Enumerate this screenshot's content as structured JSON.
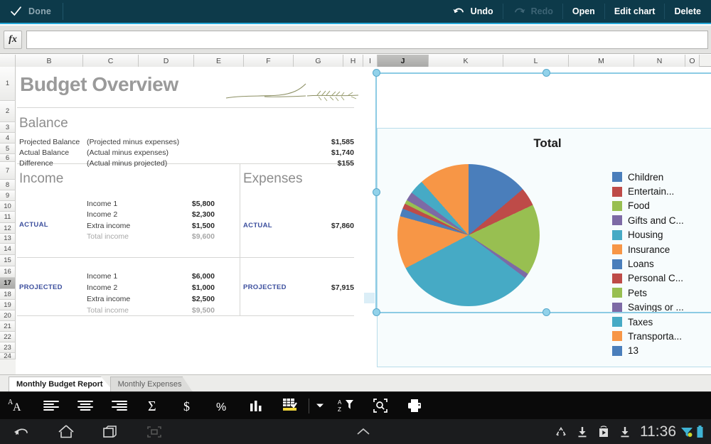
{
  "topbar": {
    "done_label": "Done",
    "check_icon": "check-icon",
    "undo_label": "Undo",
    "redo_label": "Redo",
    "open_label": "Open",
    "edit_chart_label": "Edit chart",
    "delete_label": "Delete",
    "undo_icon": "undo-arrow-icon",
    "redo_icon": "redo-arrow-icon",
    "redo_disabled": true,
    "bg_color": "#0d3a4a",
    "accent_color": "#27a8d8"
  },
  "formula_bar": {
    "fx_label": "fx",
    "value": "",
    "placeholder": ""
  },
  "spreadsheet": {
    "columns": [
      "B",
      "C",
      "D",
      "E",
      "F",
      "G",
      "H",
      "I",
      "J",
      "K",
      "L",
      "M",
      "N",
      "O"
    ],
    "selected_column": "J",
    "rows": [
      "1",
      "2",
      "3",
      "4",
      "5",
      "6",
      "7",
      "8",
      "9",
      "10",
      "11",
      "12",
      "13",
      "14",
      "15",
      "16",
      "17",
      "18",
      "19",
      "20",
      "21",
      "22",
      "23",
      "24"
    ],
    "selected_row": "17",
    "title": "Budget Overview",
    "sections": {
      "balance_heading": "Balance",
      "income_heading": "Income",
      "expenses_heading": "Expenses"
    },
    "balance_rows": [
      {
        "label": "Projected Balance",
        "note": "(Projected  minus expenses)",
        "value": "$1,585"
      },
      {
        "label": "Actual Balance",
        "note": "(Actual  minus expenses)",
        "value": "$1,740"
      },
      {
        "label": "Difference",
        "note": "(Actual minus projected)",
        "value": "$155"
      }
    ],
    "income_actual": {
      "tag": "ACTUAL",
      "lines": [
        {
          "label": "Income 1",
          "value": "$5,800",
          "muted": false
        },
        {
          "label": "Income 2",
          "value": "$2,300",
          "muted": false
        },
        {
          "label": "Extra income",
          "value": "$1,500",
          "muted": false
        },
        {
          "label": "Total income",
          "value": "$9,600",
          "muted": true
        }
      ]
    },
    "income_projected": {
      "tag": "PROJECTED",
      "lines": [
        {
          "label": "Income 1",
          "value": "$6,000",
          "muted": false
        },
        {
          "label": "Income 2",
          "value": "$1,000",
          "muted": false
        },
        {
          "label": "Extra income",
          "value": "$2,500",
          "muted": false
        },
        {
          "label": "Total income",
          "value": "$9,500",
          "muted": true
        }
      ]
    },
    "expenses_actual": {
      "tag": "ACTUAL",
      "value": "$7,860"
    },
    "expenses_projected": {
      "tag": "PROJECTED",
      "value": "$7,915"
    },
    "sheet_tabs": [
      {
        "label": "Monthly Budget Report",
        "active": true
      },
      {
        "label": "Monthly Expenses",
        "active": false
      }
    ]
  },
  "chart_data": {
    "type": "pie",
    "title": "Total",
    "selected": true,
    "legend_position": "right",
    "categories": [
      "Children",
      "Entertain...",
      "Food",
      "Gifts and C...",
      "Housing",
      "Insurance",
      "Loans",
      "Personal C...",
      "Pets",
      "Savings or ...",
      "Taxes",
      "Transporta...",
      "13"
    ],
    "colors": [
      "#4a7ebb",
      "#be4b48",
      "#98bf51",
      "#7d6aa5",
      "#46aac5",
      "#f79646",
      "#4a7ebb",
      "#be4b48",
      "#98bf51",
      "#7d6aa5",
      "#46aac5",
      "#f79646",
      "#4a7ebb"
    ],
    "values": [
      13.8,
      4.2,
      16.2,
      1.1,
      32.0,
      12.0,
      1.8,
      1.2,
      0.9,
      2.0,
      3.3,
      11.5,
      0.0
    ],
    "unit": "percent",
    "start_angle_deg": 0
  },
  "bottom_toolbar": {
    "items": [
      {
        "name": "font-size-icon",
        "label": "A"
      },
      {
        "name": "align-left-icon",
        "label": ""
      },
      {
        "name": "align-center-icon",
        "label": ""
      },
      {
        "name": "align-right-icon",
        "label": ""
      },
      {
        "name": "sum-sigma-icon",
        "label": "Σ"
      },
      {
        "name": "currency-dollar-icon",
        "label": "$"
      },
      {
        "name": "percent-icon",
        "label": "%"
      },
      {
        "name": "insert-chart-icon",
        "label": ""
      },
      {
        "name": "cell-fill-icon",
        "label": ""
      },
      {
        "name": "dropdown-caret-icon",
        "label": ""
      },
      {
        "name": "sort-filter-icon",
        "label": ""
      },
      {
        "name": "find-icon",
        "label": ""
      },
      {
        "name": "print-icon",
        "label": ""
      }
    ]
  },
  "navbar": {
    "back_icon": "back-arrow-icon",
    "home_icon": "home-icon",
    "recents_icon": "recent-apps-icon",
    "screenshot_icon": "screenshot-icon",
    "expand_icon": "chevron-up-icon",
    "status_icons": [
      "sync-recycle-icon",
      "download-icon",
      "play-store-icon",
      "download-icon"
    ],
    "time": "11:36",
    "signal_icon": "wifi-icon",
    "battery_icon": "battery-icon"
  }
}
